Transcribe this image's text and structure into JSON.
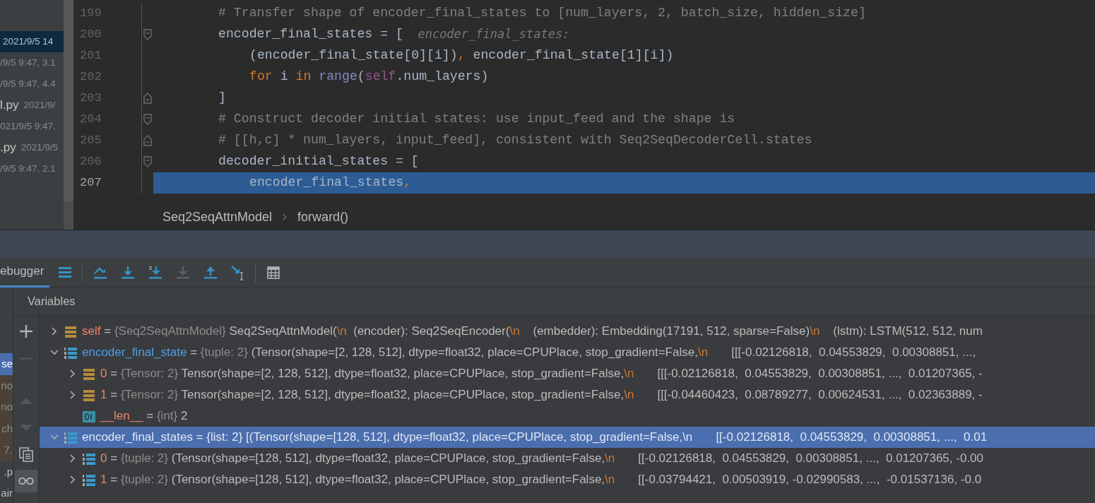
{
  "project_files": [
    {
      "detail": "2021/9/5 14",
      "selected": true
    },
    {
      "detail": "/9/5 9:47, 3.1",
      "selected": false
    },
    {
      "detail": "/9/5 9:47, 4.4",
      "selected": false
    },
    {
      "name": "l.py",
      "detail": "2021/9/",
      "selected": false
    },
    {
      "detail": "021/9/5 9:47,",
      "selected": false
    },
    {
      "name": ".py",
      "detail": "2021/9/5",
      "selected": false
    },
    {
      "detail": "/9/5 9:47, 2.1",
      "selected": false
    }
  ],
  "editor": {
    "lines": [
      {
        "number": "199",
        "current": false,
        "tokens": [
          {
            "t": "# Transfer shape of encoder_final_states to [num_layers, 2, batch_size, hidden_size]",
            "kind": "comment"
          }
        ]
      },
      {
        "number": "200",
        "current": false,
        "kind": "fold-start",
        "tokens": [
          {
            "t": "encoder_final_states = [",
            "kind": "plain"
          },
          {
            "t": "  encoder_final_states:",
            "kind": "hint"
          }
        ],
        "children": [
          {
            "number": "201",
            "current": false,
            "tokens": [
              {
                "t": "(encoder_final_state[0][i])",
                "kind": "plain"
              },
              {
                "t": ",",
                "kind": "punct"
              },
              {
                "t": " encoder_final_state[1][i])",
                "kind": "plain"
              }
            ]
          },
          {
            "number": "202",
            "current": false,
            "tokens": [
              {
                "t": "for",
                "kind": "keyword"
              },
              {
                "t": " i ",
                "kind": "plain"
              },
              {
                "t": "in",
                "kind": "keyword"
              },
              {
                "t": " range",
                "kind": "builtin"
              },
              {
                "t": "(",
                "kind": "plain"
              },
              {
                "t": "self",
                "kind": "self"
              },
              {
                "t": ".num_layers)",
                "kind": "plain"
              }
            ]
          }
        ]
      },
      {
        "number": "203",
        "current": false,
        "kind": "fold-end",
        "tokens": [
          {
            "t": "]",
            "kind": "plain"
          }
        ]
      },
      {
        "number": "204",
        "current": false,
        "kind": "fold-start",
        "tokens": [
          {
            "t": "# Construct decoder initial states: use input_feed and the shape is",
            "kind": "comment"
          }
        ]
      },
      {
        "number": "205",
        "current": false,
        "kind": "fold-end",
        "tokens": [
          {
            "t": "# [[h,c] * num_layers, input_feed], consistent with Seq2SeqDecoderCell.states",
            "kind": "comment"
          }
        ]
      },
      {
        "number": "206",
        "current": false,
        "kind": "fold-start",
        "tokens": [
          {
            "t": "decoder_initial_states = [",
            "kind": "plain"
          }
        ],
        "children": [
          {
            "number": "207",
            "current": true,
            "tokens": [
              {
                "t": "encoder_final_states",
                "kind": "plain"
              },
              {
                "t": ",",
                "kind": "punct"
              }
            ]
          }
        ]
      }
    ],
    "breadcrumbs": [
      "Seq2SeqAttnModel",
      "forward()"
    ]
  },
  "debugger": {
    "tab": {
      "label": "ebugger",
      "selected": true
    },
    "toolbar": [
      {
        "kind": "menu",
        "disabled": false
      },
      {
        "kind": "separator"
      },
      {
        "kind": "step-over",
        "disabled": false
      },
      {
        "kind": "step-into",
        "disabled": false
      },
      {
        "kind": "step-into-my-code",
        "disabled": false
      },
      {
        "kind": "force-step-into",
        "disabled": true
      },
      {
        "kind": "step-out",
        "disabled": false
      },
      {
        "kind": "run-to-cursor",
        "disabled": false
      },
      {
        "kind": "separator"
      },
      {
        "kind": "evaluate",
        "disabled": false
      }
    ],
    "frames": [
      {
        "text": "se",
        "kind": "user",
        "selected": true
      },
      {
        "text": "no",
        "kind": "library",
        "selected": false
      },
      {
        "text": "no",
        "kind": "library",
        "selected": false
      },
      {
        "text": "ch",
        "kind": "library",
        "selected": false
      },
      {
        "text": "7.",
        "kind": "library",
        "selected": false
      },
      {
        "text": ".p",
        "kind": "user",
        "selected": false
      },
      {
        "text": "air",
        "kind": "user",
        "selected": false
      }
    ],
    "variables_title": "Variables",
    "side_tools": [
      {
        "kind": "add",
        "disabled": false,
        "selected": false
      },
      {
        "kind": "remove",
        "disabled": true,
        "selected": false
      },
      {
        "kind": "up",
        "disabled": true,
        "selected": false
      },
      {
        "kind": "down",
        "disabled": true,
        "selected": false
      },
      {
        "kind": "copy",
        "disabled": false,
        "selected": false
      },
      {
        "kind": "watches",
        "disabled": false,
        "selected": true
      }
    ],
    "variables": [
      {
        "name": "self",
        "op": "=",
        "type": "{Seq2SeqAttnModel}",
        "kind": "object",
        "expanded": false,
        "changed": false,
        "selected": false,
        "value": [
          "Seq2SeqAttnModel(",
          "\\n",
          "  (encoder): Seq2SeqEncoder(",
          "\\n",
          "    (embedder): Embedding(17191, 512, sparse=False)",
          "\\n",
          "    (lstm): LSTM(512, 512, num"
        ]
      },
      {
        "name": "encoder_final_state",
        "op": "=",
        "type": "{tuple: 2}",
        "kind": "list",
        "expanded": true,
        "changed": true,
        "selected": false,
        "value": [
          "(Tensor(shape=[2, 128, 512], dtype=float32, place=CPUPlace, stop_gradient=False,",
          "\\n",
          "       [[[-0.02126818,  0.04553829,  0.00308851, ...,"
        ],
        "children": [
          {
            "name": "0",
            "op": "=",
            "type": "{Tensor: 2}",
            "kind": "object",
            "expanded": false,
            "changed": false,
            "selected": false,
            "value": [
              "Tensor(shape=[2, 128, 512], dtype=float32, place=CPUPlace, stop_gradient=False,",
              "\\n",
              "       [[[-0.02126818,  0.04553829,  0.00308851, ...,  0.01207365, -"
            ]
          },
          {
            "name": "1",
            "op": "=",
            "type": "{Tensor: 2}",
            "kind": "object",
            "expanded": false,
            "changed": false,
            "selected": false,
            "value": [
              "Tensor(shape=[2, 128, 512], dtype=float32, place=CPUPlace, stop_gradient=False,",
              "\\n",
              "       [[[-0.04460423,  0.08789277,  0.00624531, ...,  0.02363889, -"
            ]
          },
          {
            "name": "__len__",
            "op": "=",
            "type": "{int}",
            "kind": "int",
            "changed": false,
            "selected": false,
            "value": [
              "2"
            ]
          }
        ]
      },
      {
        "name": "encoder_final_states",
        "op": "=",
        "type": "{list: 2}",
        "kind": "list",
        "expanded": true,
        "changed": true,
        "selected": true,
        "value": [
          "[(Tensor(shape=[128, 512], dtype=float32, place=CPUPlace, stop_gradient=False,",
          "\\n",
          "       [[-0.02126818,  0.04553829,  0.00308851, ...,  0.01"
        ],
        "children": [
          {
            "name": "0",
            "op": "=",
            "type": "{tuple: 2}",
            "kind": "list",
            "expanded": false,
            "changed": false,
            "selected": false,
            "value": [
              "(Tensor(shape=[128, 512], dtype=float32, place=CPUPlace, stop_gradient=False,",
              "\\n",
              "       [[-0.02126818,  0.04553829,  0.00308851, ...,  0.01207365, -0.00"
            ]
          },
          {
            "name": "1",
            "op": "=",
            "type": "{tuple: 2}",
            "kind": "list",
            "expanded": false,
            "changed": false,
            "selected": false,
            "value": [
              "(Tensor(shape=[128, 512], dtype=float32, place=CPUPlace, stop_gradient=False,",
              "\\n",
              "       [[-0.03794421,  0.00503919, -0.02990583, ...,  -0.01537136, -0.0"
            ]
          }
        ]
      }
    ]
  }
}
